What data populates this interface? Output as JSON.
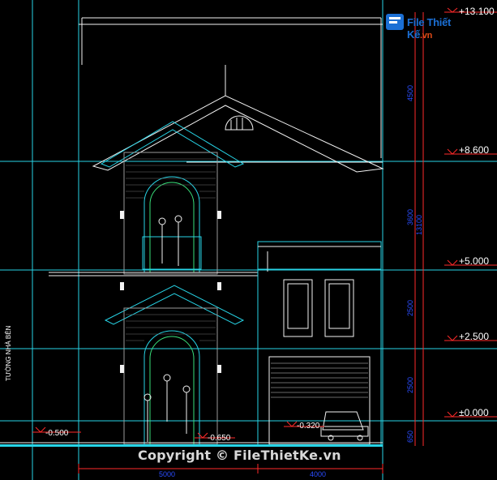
{
  "brand": {
    "name": "File Thiết Kế",
    "tld": ".vn",
    "accent": "#1b6fd4",
    "accent2": "#e04a17"
  },
  "watermark": "Copyright © FileThietKe.vn",
  "side_label": "TƯỜNG NHÀ BÊN",
  "levels": {
    "roof_top": "+13.100",
    "l3": "+8.600",
    "l2": "+5.000",
    "l1": "+2.500",
    "ground": "±0.000",
    "left_ground": "-0.500",
    "step": "-0.650",
    "garage": "-0.320"
  },
  "dims_vertical": [
    "4500",
    "3600",
    "2500",
    "2500",
    "650"
  ],
  "dim_total": "13100",
  "dims_horizontal": [
    "5000",
    "4000"
  ],
  "colors": {
    "cyan": "#27d4e6",
    "white": "#f2f2f2",
    "grey": "#9a9a9a",
    "green": "#39e07a",
    "red": "#ff2a2a",
    "blue": "#2a4cff"
  }
}
